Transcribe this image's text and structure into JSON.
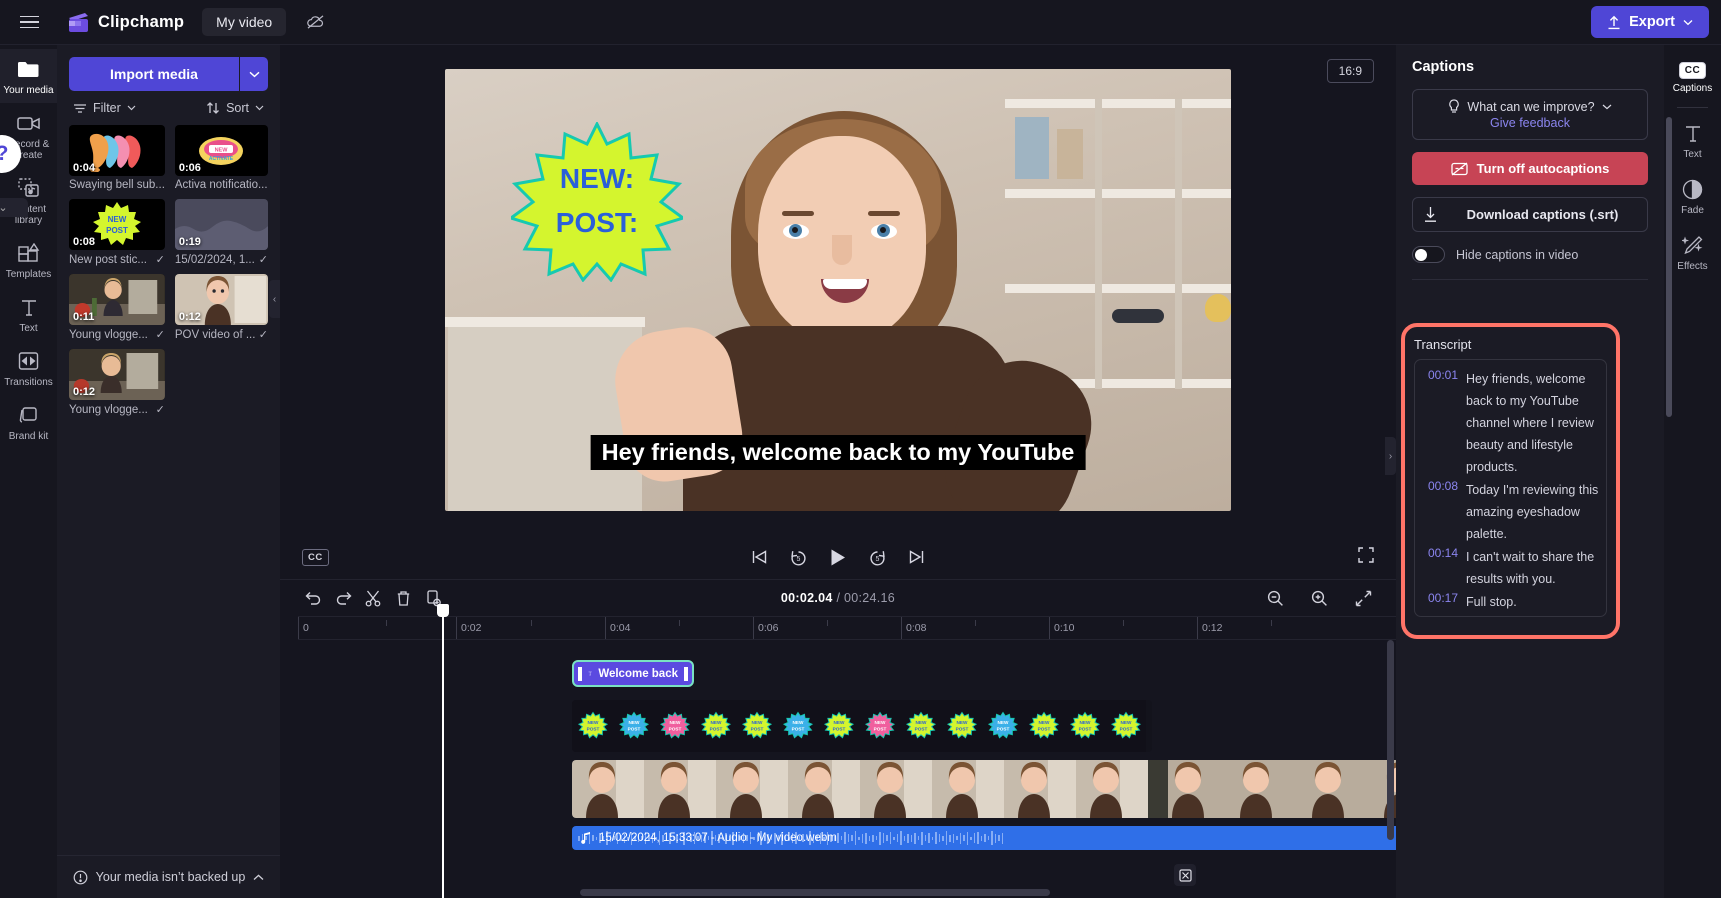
{
  "topbar": {
    "menu_icon": "hamburger-icon",
    "brand": "Clipchamp",
    "project_name": "My video",
    "cloud_icon": "cloud-off-icon",
    "export_label": "Export"
  },
  "left_rail": {
    "items": [
      {
        "label": "Your media",
        "icon": "folder-icon",
        "active": true
      },
      {
        "label": "Record & create",
        "icon": "camera-icon",
        "active": false
      },
      {
        "label": "Content library",
        "icon": "library-icon",
        "active": false
      },
      {
        "label": "Templates",
        "icon": "templates-icon",
        "active": false
      },
      {
        "label": "Text",
        "icon": "text-icon",
        "active": false
      },
      {
        "label": "Transitions",
        "icon": "transitions-icon",
        "active": false
      },
      {
        "label": "Brand kit",
        "icon": "brand-kit-icon",
        "active": false
      }
    ]
  },
  "media_panel": {
    "import_label": "Import media",
    "import_caret": "chevron-down-icon",
    "filter_label": "Filter",
    "sort_label": "Sort",
    "items": [
      {
        "duration": "0:04",
        "title": "Swaying bell sub...",
        "selected": false,
        "kind": "bells"
      },
      {
        "duration": "0:06",
        "title": "Activa notificatio...",
        "selected": false,
        "kind": "badge"
      },
      {
        "duration": "0:08",
        "title": "New post stic...",
        "selected": true,
        "kind": "newpost"
      },
      {
        "duration": "0:19",
        "title": "15/02/2024, 1...",
        "selected": true,
        "kind": "audio"
      },
      {
        "duration": "0:11",
        "title": "Young vlogge...",
        "selected": true,
        "kind": "kitchen"
      },
      {
        "duration": "0:12",
        "title": "POV video of ...",
        "selected": true,
        "kind": "pov"
      },
      {
        "duration": "0:12",
        "title": "Young vlogge...",
        "selected": true,
        "kind": "kitchen"
      }
    ],
    "backup_notice": "Your media isn’t backed up",
    "backup_chevron": "chevron-up-icon"
  },
  "preview": {
    "aspect_ratio": "16:9",
    "caption_text": "Hey friends, welcome back to my YouTube",
    "sticker_line1": "NEW:",
    "sticker_line2": "POST:",
    "controls": {
      "cc_label": "CC",
      "skip_start": "skip-to-start-icon",
      "back5": "rewind-5s-icon",
      "play": "play-icon",
      "fwd5": "forward-5s-icon",
      "skip_end": "skip-to-end-icon",
      "fullscreen": "fullscreen-icon"
    },
    "help_label": "?"
  },
  "timeline": {
    "tools": [
      {
        "name": "undo-icon"
      },
      {
        "name": "redo-icon"
      },
      {
        "name": "split-icon"
      },
      {
        "name": "delete-icon"
      },
      {
        "name": "duplicate-icon"
      }
    ],
    "current_time": "00:02.04",
    "total_time": "/ 00:24.16",
    "zoom_out_icon": "zoom-out-icon",
    "zoom_in_icon": "zoom-in-icon",
    "fit_icon": "fit-to-screen-icon",
    "ruler_labels": [
      "0",
      "0:02",
      "0:04",
      "0:06",
      "0:08",
      "0:10",
      "0:12"
    ],
    "text_clip_label": "Welcome back",
    "text_clip_icon": "text-icon",
    "audio_clip_label": "15/02/2024, 15:33:07 - Audio - My video.webm",
    "audio_clip_icon": "music-note-icon",
    "detach_icon": "detach-audio-icon"
  },
  "captions_panel": {
    "title": "Captions",
    "feedback_question": "What can we improve?",
    "feedback_chevron": "chevron-down-icon",
    "feedback_link": "Give feedback",
    "turn_off_label": "Turn off autocaptions",
    "turn_off_icon": "captions-off-icon",
    "download_label": "Download captions (.srt)",
    "download_icon": "download-icon",
    "hide_captions_label": "Hide captions in video",
    "hide_captions_on": false,
    "transcript_title": "Transcript",
    "transcript": [
      {
        "time": "00:01",
        "text": "Hey friends, welcome back to my YouTube channel where I review beauty and lifestyle products."
      },
      {
        "time": "00:08",
        "text": "Today I'm reviewing this amazing eyeshadow palette."
      },
      {
        "time": "00:14",
        "text": "I can't wait to share the results with you."
      },
      {
        "time": "00:17",
        "text": "Full stop."
      }
    ],
    "highlight_color": "#ff7468"
  },
  "right_rail": {
    "items": [
      {
        "label": "Captions",
        "icon": "cc-icon",
        "active": true
      },
      {
        "label": "Text",
        "icon": "text-icon",
        "active": false
      },
      {
        "label": "Fade",
        "icon": "fade-icon",
        "active": false
      },
      {
        "label": "Effects",
        "icon": "effects-icon",
        "active": false
      }
    ]
  },
  "colors": {
    "accent": "#4f46d6",
    "danger": "#c74455",
    "link": "#8b85ef",
    "selection": "#79e2c2",
    "audio_clip": "#2f6fe8"
  }
}
